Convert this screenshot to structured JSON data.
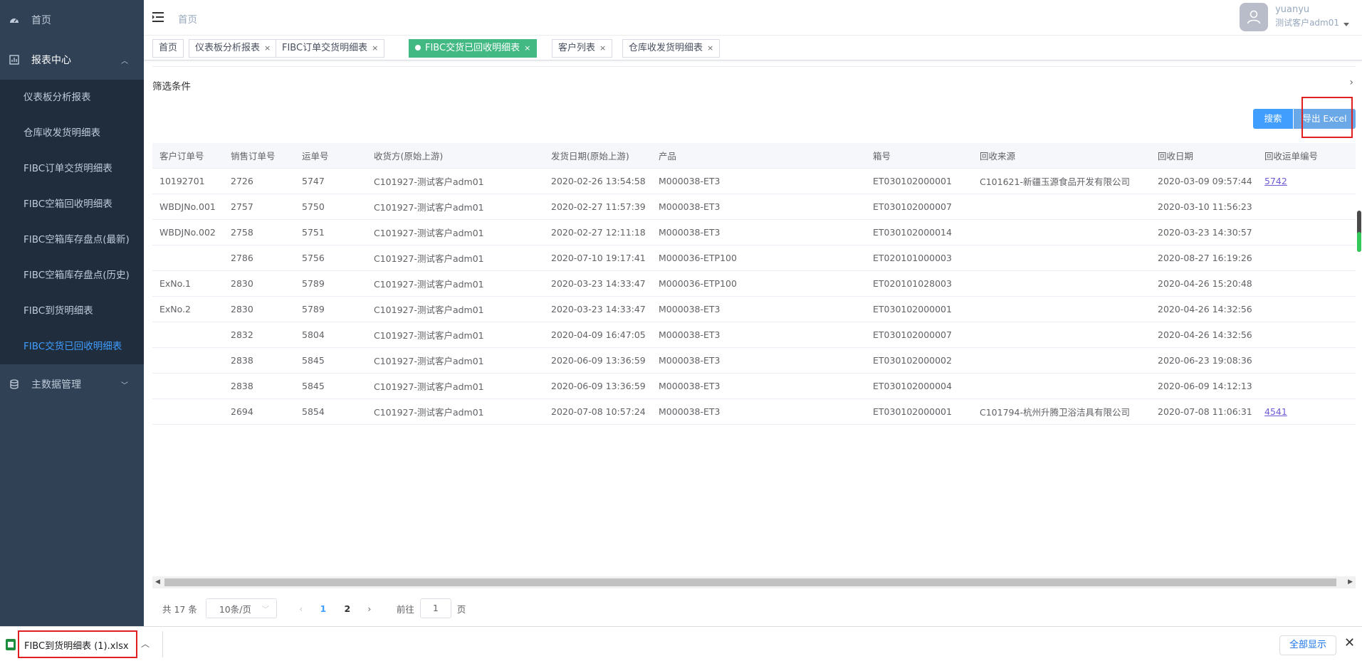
{
  "sidebar": {
    "home": "首页",
    "reports": "报表中心",
    "report_items": [
      "仪表板分析报表",
      "仓库收发货明细表",
      "FIBC订单交货明细表",
      "FIBC空箱回收明细表",
      "FIBC空箱库存盘点(最新)",
      "FIBC空箱库存盘点(历史)",
      "FIBC到货明细表",
      "FIBC交货已回收明细表"
    ],
    "master": "主数据管理"
  },
  "header": {
    "breadcrumb": "首页",
    "user_name": "yuanyu",
    "company": "测试客户adm01"
  },
  "tags": [
    {
      "label": "首页"
    },
    {
      "label": "仪表板分析报表"
    },
    {
      "label": "FIBC订单交货明细表"
    },
    {
      "label": "FIBC交货已回收明细表"
    },
    {
      "label": "客户列表"
    },
    {
      "label": "仓库收发货明细表"
    }
  ],
  "filter": {
    "title": "筛选条件"
  },
  "buttons": {
    "search": "搜索",
    "export": "导出 Excel"
  },
  "table": {
    "headers": [
      "客户订单号",
      "销售订单号",
      "运单号",
      "收货方(原始上游)",
      "发货日期(原始上游)",
      "产品",
      "箱号",
      "回收来源",
      "回收日期",
      "回收运单编号"
    ],
    "rows": [
      [
        "10192701",
        "2726",
        "5747",
        "C101927-测试客户adm01",
        "2020-02-26 13:54:58",
        "M000038-ET3",
        "ET030102000001",
        "C101621-新疆玉源食品开发有限公司",
        "2020-03-09 09:57:44",
        "5742"
      ],
      [
        "WBDJNo.001",
        "2757",
        "5750",
        "C101927-测试客户adm01",
        "2020-02-27 11:57:39",
        "M000038-ET3",
        "ET030102000007",
        "",
        "2020-03-10 11:56:23",
        ""
      ],
      [
        "WBDJNo.002",
        "2758",
        "5751",
        "C101927-测试客户adm01",
        "2020-02-27 12:11:18",
        "M000038-ET3",
        "ET030102000014",
        "",
        "2020-03-23 14:30:57",
        ""
      ],
      [
        "",
        "2786",
        "5756",
        "C101927-测试客户adm01",
        "2020-07-10 19:17:41",
        "M000036-ETP100",
        "ET020101000003",
        "",
        "2020-08-27 16:19:26",
        ""
      ],
      [
        "ExNo.1",
        "2830",
        "5789",
        "C101927-测试客户adm01",
        "2020-03-23 14:33:47",
        "M000036-ETP100",
        "ET020101028003",
        "",
        "2020-04-26 15:20:48",
        ""
      ],
      [
        "ExNo.2",
        "2830",
        "5789",
        "C101927-测试客户adm01",
        "2020-03-23 14:33:47",
        "M000038-ET3",
        "ET030102000001",
        "",
        "2020-04-26 14:32:56",
        ""
      ],
      [
        "",
        "2832",
        "5804",
        "C101927-测试客户adm01",
        "2020-04-09 16:47:05",
        "M000038-ET3",
        "ET030102000007",
        "",
        "2020-04-26 14:32:56",
        ""
      ],
      [
        "",
        "2838",
        "5845",
        "C101927-测试客户adm01",
        "2020-06-09 13:36:59",
        "M000038-ET3",
        "ET030102000002",
        "",
        "2020-06-23 19:08:36",
        ""
      ],
      [
        "",
        "2838",
        "5845",
        "C101927-测试客户adm01",
        "2020-06-09 13:36:59",
        "M000038-ET3",
        "ET030102000004",
        "",
        "2020-06-09 14:12:13",
        ""
      ],
      [
        "",
        "2694",
        "5854",
        "C101927-测试客户adm01",
        "2020-07-08 10:57:24",
        "M000038-ET3",
        "ET030102000001",
        "C101794-杭州升腾卫浴洁具有限公司",
        "2020-07-08 11:06:31",
        "4541"
      ]
    ]
  },
  "pagination": {
    "total": "共 17 条",
    "page_size": "10条/页",
    "pages": [
      "1",
      "2"
    ],
    "goto_prefix": "前往",
    "goto_value": "1",
    "goto_suffix": "页"
  },
  "download": {
    "filename": "FIBC到货明细表 (1).xlsx",
    "show_all": "全部显示"
  }
}
